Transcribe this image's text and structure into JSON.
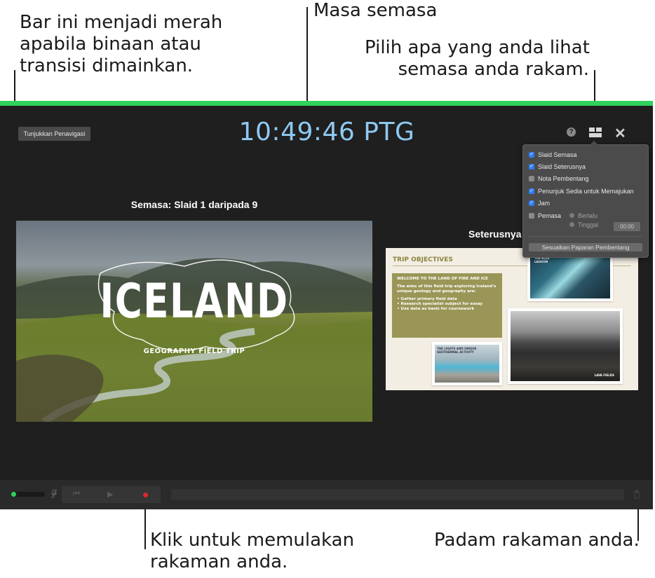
{
  "callouts": {
    "bar": [
      "Bar ini menjadi merah",
      "apabila binaan atau",
      "transisi dimainkan."
    ],
    "time": "Masa semasa",
    "layout": [
      "Pilih apa yang anda lihat",
      "semasa anda rakam."
    ],
    "record": [
      "Klik untuk memulakan",
      "rakaman anda."
    ],
    "delete": "Padam rakaman anda."
  },
  "presenter": {
    "show_navigator_label": "Tunjukkan Penavigasi",
    "clock": "10:49:46 PTG",
    "current_label": "Semasa: Slaid 1 daripada 9",
    "next_label": "Seterusnya",
    "colors": {
      "ready_bar": "#2fd25c",
      "clock": "#8ec9f2",
      "record": "#e0262d"
    },
    "icons": [
      "help-icon",
      "layout-icon",
      "close-icon",
      "mic-muted-icon",
      "previous-icon",
      "play-icon",
      "record-icon",
      "trash-icon"
    ]
  },
  "current_slide": {
    "title": "ICELAND",
    "subtitle": "GEOGRAPHY FIELD TRIP"
  },
  "next_slide": {
    "title": "TRIP OBJECTIVES",
    "box_heading": "WELCOME TO THE LAND OF FIRE AND ICE",
    "box_intro": "The aims of this field trip exploring Iceland's unique geology and geography are:",
    "bullets": [
      "• Gather primary field data",
      "• Research specialist subject for essay",
      "• Use data as basis for coursework"
    ],
    "caption_river": "THE BLUE LAGOON",
    "caption_geyser": "THE LIGHTS AND UNIQUE GEOTHERMAL ACTIVITY",
    "caption_mountain": "LAVA FIELDS"
  },
  "layout_popover": {
    "options": [
      {
        "label": "Slaid Semasa",
        "checked": true
      },
      {
        "label": "Slaid Seterusnya",
        "checked": true
      },
      {
        "label": "Nota Pembentang",
        "checked": false
      },
      {
        "label": "Penunjuk Sedia untuk Memajukan",
        "checked": true
      },
      {
        "label": "Jam",
        "checked": true
      },
      {
        "label": "Pemasa",
        "checked": false
      }
    ],
    "timer_modes": [
      "Berlalu",
      "Tinggal"
    ],
    "timer_value": "00:00",
    "customize_label": "Sesuaikan Paparan Pembentang"
  },
  "controls": {
    "audio_level": 0.15
  }
}
